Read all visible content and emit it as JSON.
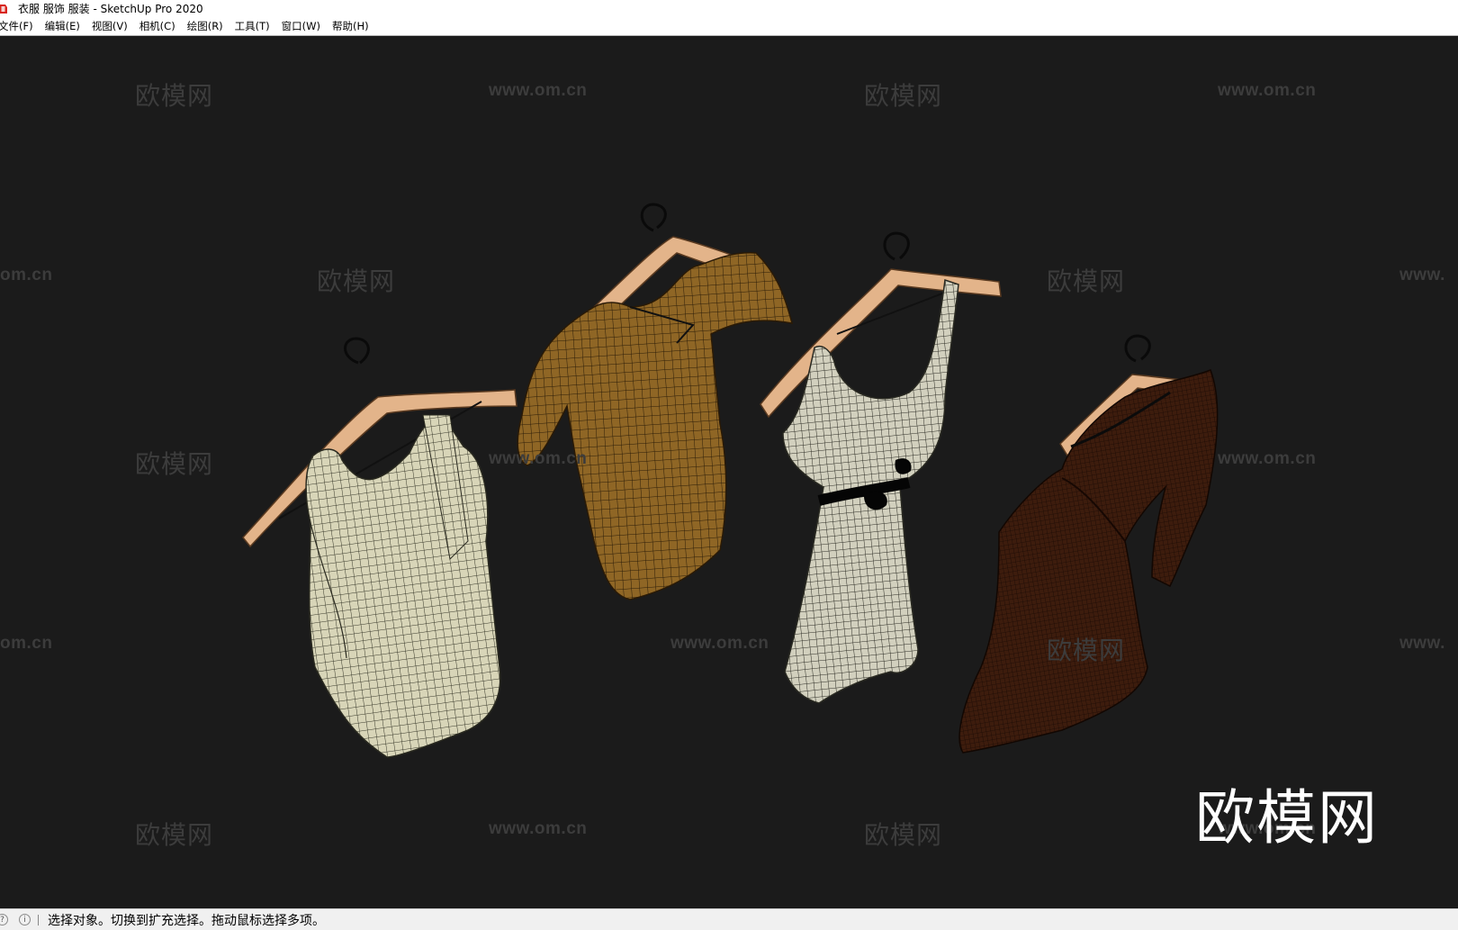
{
  "window": {
    "title": "衣服 服饰 服装 - SketchUp Pro 2020"
  },
  "menu": [
    {
      "label": "文件(F)"
    },
    {
      "label": "编辑(E)"
    },
    {
      "label": "视图(V)"
    },
    {
      "label": "相机(C)"
    },
    {
      "label": "绘图(R)"
    },
    {
      "label": "工具(T)"
    },
    {
      "label": "窗口(W)"
    },
    {
      "label": "帮助(H)"
    }
  ],
  "watermarks": {
    "brand": "欧模网",
    "url": "www.om.cn",
    "url_partial": "om.cn",
    "url_cut": "www."
  },
  "logo": {
    "text": "欧模网",
    "color": "#ffffff"
  },
  "status": {
    "text": "选择对象。切换到扩充选择。拖动鼠标选择多项。",
    "icons": [
      "help-icon",
      "info-icon"
    ]
  },
  "colors": {
    "viewport_bg": "#1b1b1b",
    "hanger_wood": "#e3b48a",
    "garment_white": "#d6d3b6",
    "garment_ochre": "#8a6322",
    "garment_dress": "#cfcdbb",
    "garment_dark_brown": "#3a1a0c",
    "app_icon_red": "#d8241c"
  }
}
